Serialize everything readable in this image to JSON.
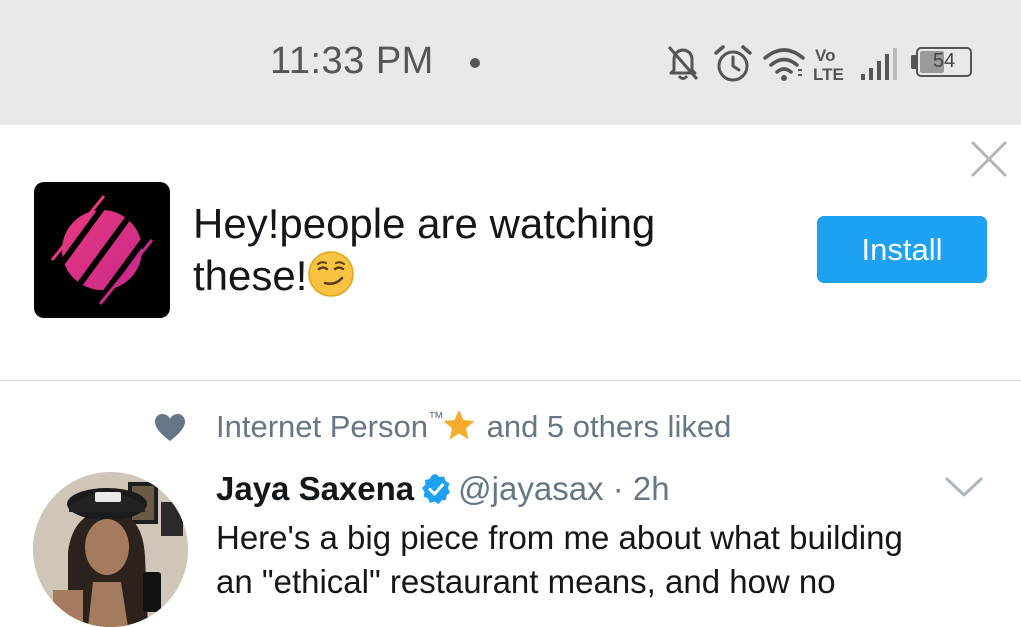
{
  "status_bar": {
    "time": "11:33 PM",
    "network_label": "Vo LTE",
    "battery_level": "54",
    "icons": [
      "notifications-off-icon",
      "alarm-icon",
      "wifi-icon",
      "volte-icon",
      "signal-icon",
      "battery-icon"
    ]
  },
  "banner": {
    "message_line1": "Hey!people are watching",
    "message_line2": "these!",
    "emoji": "smirking-face-emoji",
    "install_label": "Install",
    "accent_color": "#1da1f2"
  },
  "social_context": {
    "liked_by": "Internet Person",
    "trademark": "™",
    "suffix": "and 5 others liked"
  },
  "tweet": {
    "name": "Jaya Saxena",
    "handle": "@jayasax",
    "separator": "·",
    "time": "2h",
    "text_line1": "Here's a big piece from me about what building",
    "text_line2": "an \"ethical\" restaurant means, and how no"
  }
}
